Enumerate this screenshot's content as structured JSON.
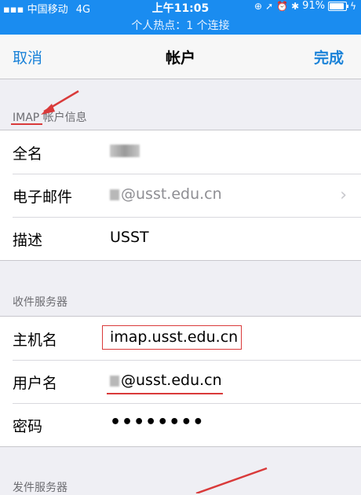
{
  "status_bar": {
    "carrier": "中国移动",
    "network": "4G",
    "time": "上午11:05",
    "battery": "91%",
    "battery_level": 0.91,
    "hotspot": "个人热点：1 个连接"
  },
  "nav": {
    "cancel_label": "取消",
    "title": "帐户",
    "done_label": "完成"
  },
  "imap_section": {
    "header_prefix": "IMAP",
    "header_suffix": " 帐户信息",
    "rows": [
      {
        "label": "全名",
        "value": ""
      },
      {
        "label": "电子邮件",
        "value": "@usst.edu.cn"
      },
      {
        "label": "描述",
        "value": "USST"
      }
    ]
  },
  "incoming_section": {
    "header": "收件服务器",
    "rows": [
      {
        "label": "主机名",
        "value": "imap.usst.edu.cn"
      },
      {
        "label": "用户名",
        "value": "@usst.edu.cn"
      },
      {
        "label": "密码",
        "value": "••••••••"
      }
    ]
  },
  "outgoing_section": {
    "header": "发件服务器"
  },
  "colors": {
    "status_bar": "#1a8cf0",
    "accent": "#1a82d8",
    "annotation": "#d93a3a"
  }
}
